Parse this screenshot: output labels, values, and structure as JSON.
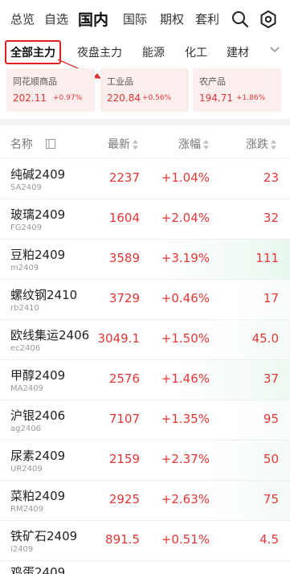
{
  "top_nav": {
    "tabs": [
      "总览",
      "自选",
      "国内",
      "国际",
      "期权",
      "套利"
    ],
    "active_tab": "国内",
    "search_icon": "search-icon",
    "settings_icon": "gear-icon"
  },
  "sub_tabs": {
    "items": [
      "全部主力",
      "夜盘主力",
      "能源",
      "化工",
      "建材"
    ],
    "selected": "全部主力",
    "more_icon": "chevron-down-icon"
  },
  "index_cards": [
    {
      "name": "同花顺商品",
      "price": "202.11",
      "change": "+0.97%"
    },
    {
      "name": "工业品",
      "price": "220.84",
      "change": "+0.56%"
    },
    {
      "name": "农产品",
      "price": "194.71",
      "change": "+1.86%"
    }
  ],
  "table": {
    "headers": {
      "name": "名称",
      "latest": "最新",
      "pct": "涨幅",
      "change": "涨跌"
    },
    "rows": [
      {
        "name": "纯碱2409",
        "code": "SA2409",
        "price": "2237",
        "pct": "+1.04%",
        "chg": "23"
      },
      {
        "name": "玻璃2409",
        "code": "FG2409",
        "price": "1604",
        "pct": "+2.04%",
        "chg": "32"
      },
      {
        "name": "豆粕2409",
        "code": "m2409",
        "price": "3589",
        "pct": "+3.19%",
        "chg": "111"
      },
      {
        "name": "螺纹钢2410",
        "code": "rb2410",
        "price": "3729",
        "pct": "+0.46%",
        "chg": "17"
      },
      {
        "name": "欧线集运2406",
        "code": "ec2406",
        "price": "3049.1",
        "pct": "+1.50%",
        "chg": "45.0"
      },
      {
        "name": "甲醇2409",
        "code": "MA2409",
        "price": "2576",
        "pct": "+1.46%",
        "chg": "37"
      },
      {
        "name": "沪银2406",
        "code": "ag2406",
        "price": "7107",
        "pct": "+1.35%",
        "chg": "95"
      },
      {
        "name": "尿素2409",
        "code": "UR2409",
        "price": "2159",
        "pct": "+2.37%",
        "chg": "50"
      },
      {
        "name": "菜粕2409",
        "code": "RM2409",
        "price": "2925",
        "pct": "+2.63%",
        "chg": "75"
      },
      {
        "name": "铁矿石2409",
        "code": "i2409",
        "price": "891.5",
        "pct": "+0.51%",
        "chg": "4.5"
      }
    ],
    "partial_row_name": "鸡蛋2409"
  },
  "colors": {
    "up": "#e23636",
    "accent": "#e02020",
    "card_bg": "#fdeeee"
  }
}
